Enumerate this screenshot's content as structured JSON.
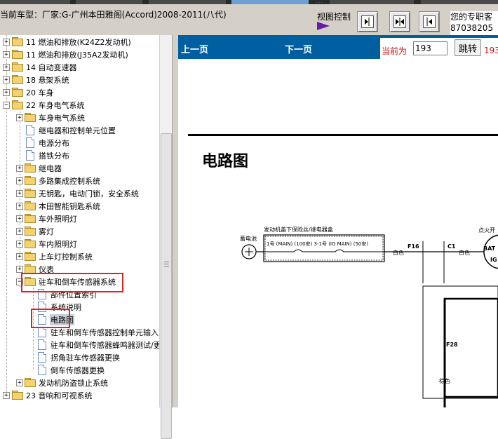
{
  "header": {
    "car_title": "当前车型：厂家:G-广州本田雅阁(Accord)2008-2011(八代)",
    "view_control_label": "视图控制",
    "ellipsis": "...",
    "user_line1": "您的专职客",
    "user_line2": "87038205"
  },
  "tree": {
    "items": [
      {
        "label": "11 燃油和排放(K24Z2发动机)"
      },
      {
        "label": "11 燃油和排放(J35A2发动机)"
      },
      {
        "label": "14 自动变速器"
      },
      {
        "label": "18 悬架系统"
      },
      {
        "label": "20 车身"
      },
      {
        "label": "22 车身电气系统"
      },
      {
        "label": "车身电气系统"
      },
      {
        "label": "继电器和控制单元位置"
      },
      {
        "label": "电源分布"
      },
      {
        "label": "搭铁分布"
      },
      {
        "label": "继电器"
      },
      {
        "label": "多路集成控制系统"
      },
      {
        "label": "无钥匙，电动门锁，安全系统"
      },
      {
        "label": "本田智能钥匙系统"
      },
      {
        "label": "车外照明灯"
      },
      {
        "label": "雾灯"
      },
      {
        "label": "车内照明灯"
      },
      {
        "label": "上车灯控制系统"
      },
      {
        "label": "仪表"
      },
      {
        "label": "驻车和倒车传感器系统"
      },
      {
        "label": "部件位置索引"
      },
      {
        "label": "系统说明"
      },
      {
        "label": "电路图"
      },
      {
        "label": "驻车和倒车传感器控制单元输入"
      },
      {
        "label": "驻车和倒车传感器蜂鸣器测试/更"
      },
      {
        "label": "拐角驻车传感器更换"
      },
      {
        "label": "倒车传感器更换"
      },
      {
        "label": "发动机防盗锁止系统"
      },
      {
        "label": "23 音响和可视系统"
      }
    ]
  },
  "nav": {
    "prev": "上一页",
    "next": "下一页",
    "current_label": "当前为",
    "page_value": "193",
    "jump": "跳转",
    "total": "193"
  },
  "document": {
    "heading": "电路图",
    "diagram": {
      "battery": "蓄电池",
      "fuse_box": "发动机盖下保险丝/继电器盒",
      "fuse_text": "1号 (MAIN) (100安)  3-1号 (IG MAIN) (50安)",
      "white_1": "白色",
      "white_2": "白色",
      "f16": "F16",
      "c1": "C1",
      "ignition": "点火开",
      "bat": "BAT",
      "ig": "IG",
      "f28": "F28",
      "brown": "棕色"
    }
  }
}
